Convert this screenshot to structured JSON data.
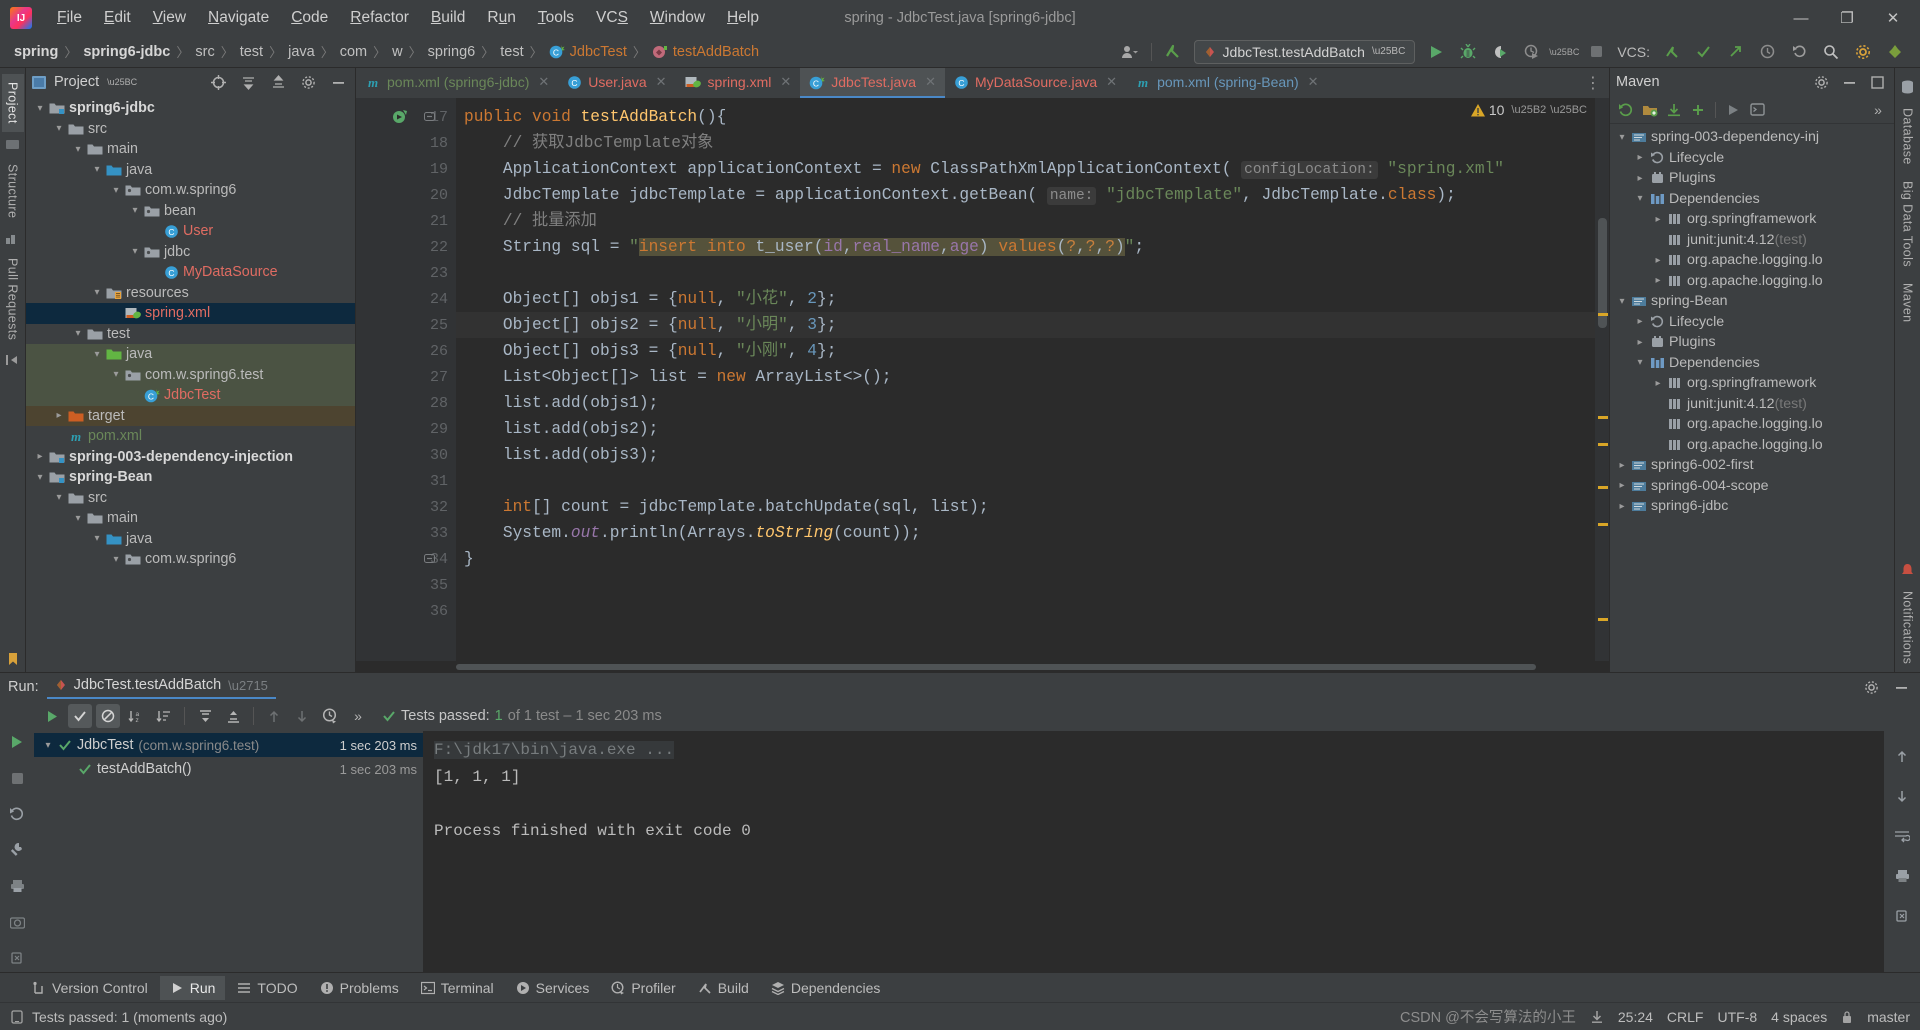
{
  "window": {
    "title": "spring - JdbcTest.java [spring6-jdbc]",
    "logo_icon": "intellij-idea-logo",
    "controls": {
      "minimize": "—",
      "maximize": "❐",
      "close": "✕"
    }
  },
  "menu": {
    "items": [
      "File",
      "Edit",
      "View",
      "Navigate",
      "Code",
      "Refactor",
      "Build",
      "Run",
      "Tools",
      "VCS",
      "Window",
      "Help"
    ]
  },
  "navbar": {
    "breadcrumbs": [
      {
        "label": "spring",
        "style": "bold"
      },
      {
        "label": "spring6-jdbc",
        "style": "bold"
      },
      {
        "label": "src",
        "style": "plain"
      },
      {
        "label": "test",
        "style": "plain"
      },
      {
        "label": "java",
        "style": "plain"
      },
      {
        "label": "com",
        "style": "plain"
      },
      {
        "label": "w",
        "style": "plain"
      },
      {
        "label": "spring6",
        "style": "plain"
      },
      {
        "label": "test",
        "style": "plain"
      },
      {
        "label": "JdbcTest",
        "style": "orange",
        "icon": "java-test-class-icon"
      },
      {
        "label": "testAddBatch",
        "style": "orange",
        "icon": "method-icon"
      }
    ],
    "separator": "〉",
    "run_config": "JdbcTest.testAddBatch",
    "vcs_label": "VCS:",
    "icons": [
      "user-icon",
      "vcs-update-icon",
      "run-icon",
      "debug-icon",
      "run-coverage-icon",
      "profiler-icon",
      "stop-icon",
      "search-icon",
      "settings-icon",
      "notifications-icon"
    ]
  },
  "left_strip": {
    "items": [
      "Project",
      "Structure",
      "Pull Requests"
    ],
    "active": "Project"
  },
  "right_strip": {
    "items": [
      "Database",
      "Big Data Tools",
      "Maven",
      "Notifications"
    ]
  },
  "project_panel": {
    "title": "Project",
    "toolbar_icons": [
      "locate-icon",
      "expand-all-icon",
      "collapse-all-icon",
      "settings-icon",
      "hide-icon"
    ],
    "tree": [
      {
        "label": "spring6-jdbc",
        "depth": 1,
        "chev": "down",
        "icon": "module-folder",
        "style": "bold"
      },
      {
        "label": "src",
        "depth": 2,
        "chev": "down",
        "icon": "folder"
      },
      {
        "label": "main",
        "depth": 3,
        "chev": "down",
        "icon": "folder"
      },
      {
        "label": "java",
        "depth": 4,
        "chev": "down",
        "icon": "source-folder-blue"
      },
      {
        "label": "com.w.spring6",
        "depth": 5,
        "chev": "down",
        "icon": "package"
      },
      {
        "label": "bean",
        "depth": 6,
        "chev": "down",
        "icon": "package"
      },
      {
        "label": "User",
        "depth": 7,
        "chev": "none",
        "icon": "class",
        "style": "red"
      },
      {
        "label": "jdbc",
        "depth": 6,
        "chev": "down",
        "icon": "package"
      },
      {
        "label": "MyDataSource",
        "depth": 7,
        "chev": "none",
        "icon": "class",
        "style": "red"
      },
      {
        "label": "resources",
        "depth": 4,
        "chev": "down",
        "icon": "resources-folder"
      },
      {
        "label": "spring.xml",
        "depth": 5,
        "chev": "none",
        "icon": "spring-xml",
        "style": "red",
        "row": "selected"
      },
      {
        "label": "test",
        "depth": 3,
        "chev": "down",
        "icon": "folder"
      },
      {
        "label": "java",
        "depth": 4,
        "chev": "down",
        "icon": "test-source-folder-green",
        "row": "testsrc"
      },
      {
        "label": "com.w.spring6.test",
        "depth": 5,
        "chev": "down",
        "icon": "package",
        "row": "testsrc"
      },
      {
        "label": "JdbcTest",
        "depth": 6,
        "chev": "none",
        "icon": "test-class",
        "style": "red",
        "row": "testsrc"
      },
      {
        "label": "target",
        "depth": 2,
        "chev": "right",
        "icon": "excluded-folder",
        "row": "targetrow"
      },
      {
        "label": "pom.xml",
        "depth": 2,
        "chev": "none",
        "icon": "maven-pom",
        "style": "green"
      },
      {
        "label": "spring-003-dependency-injection",
        "depth": 1,
        "chev": "right",
        "icon": "module-folder",
        "style": "bold"
      },
      {
        "label": "spring-Bean",
        "depth": 1,
        "chev": "down",
        "icon": "module-folder",
        "style": "bold"
      },
      {
        "label": "src",
        "depth": 2,
        "chev": "down",
        "icon": "folder"
      },
      {
        "label": "main",
        "depth": 3,
        "chev": "down",
        "icon": "folder"
      },
      {
        "label": "java",
        "depth": 4,
        "chev": "down",
        "icon": "source-folder-blue"
      },
      {
        "label": "com.w.spring6",
        "depth": 5,
        "chev": "down",
        "icon": "package"
      }
    ]
  },
  "editor": {
    "tabs": [
      {
        "label": "pom.xml (spring6-jdbc)",
        "icon": "maven-icon",
        "color": "green",
        "active": false
      },
      {
        "label": "User.java",
        "icon": "class-icon",
        "color": "red",
        "active": false
      },
      {
        "label": "spring.xml",
        "icon": "spring-icon",
        "color": "red",
        "active": false
      },
      {
        "label": "JdbcTest.java",
        "icon": "test-class-icon",
        "color": "red",
        "active": true
      },
      {
        "label": "MyDataSource.java",
        "icon": "class-icon",
        "color": "red",
        "active": false
      },
      {
        "label": "pom.xml (spring-Bean)",
        "icon": "maven-icon",
        "color": "blue",
        "active": false
      }
    ],
    "warning_count": "10",
    "warning_icon": "warning-triangle-icon",
    "first_line_number": 17,
    "lines": [
      {
        "n": 17,
        "gutter_icon": "run-test-icon",
        "fold": true
      },
      {
        "n": 18
      },
      {
        "n": 19
      },
      {
        "n": 20
      },
      {
        "n": 21
      },
      {
        "n": 22
      },
      {
        "n": 23
      },
      {
        "n": 24
      },
      {
        "n": 25,
        "current": true
      },
      {
        "n": 26
      },
      {
        "n": 27
      },
      {
        "n": 28
      },
      {
        "n": 29
      },
      {
        "n": 30
      },
      {
        "n": 31
      },
      {
        "n": 32
      },
      {
        "n": 33
      },
      {
        "n": 34,
        "fold": true
      },
      {
        "n": 35
      },
      {
        "n": 36
      }
    ],
    "code_text": [
      "public void testAddBatch(){",
      "    // 获取JdbcTemplate对象",
      "    ApplicationContext applicationContext = new ClassPathXmlApplicationContext( configLocation: \"spring.xml\"",
      "    JdbcTemplate jdbcTemplate = applicationContext.getBean( name: \"jdbcTemplate\", JdbcTemplate.class);",
      "    // 批量添加",
      "    String sql = \"insert into t_user(id,real_name,age) values(?,?,?)\";",
      "",
      "    Object[] objs1 = {null, \"小花\", 2};",
      "    Object[] objs2 = {null, \"小明\", 3};",
      "    Object[] objs3 = {null, \"小刚\", 4};",
      "    List<Object[]> list = new ArrayList<>();",
      "    list.add(objs1);",
      "    list.add(objs2);",
      "    list.add(objs3);",
      "",
      "    int[] count = jdbcTemplate.batchUpdate(sql, list);",
      "    System.out.println(Arrays.toString(count));",
      "}",
      "",
      ""
    ]
  },
  "maven_panel": {
    "title": "Maven",
    "toolbar_icons": [
      "reload-icon",
      "add-maven-project-icon",
      "download-sources-icon",
      "add-icon",
      "run-icon",
      "execute-goal-icon",
      "more-icon"
    ],
    "head_icons": [
      "settings-icon",
      "hide-icon",
      "collapse-icon"
    ],
    "tree": [
      {
        "label": "spring-003-dependency-inj",
        "depth": 1,
        "chev": "down",
        "icon": "maven-project"
      },
      {
        "label": "Lifecycle",
        "depth": 2,
        "chev": "right",
        "icon": "lifecycle"
      },
      {
        "label": "Plugins",
        "depth": 2,
        "chev": "right",
        "icon": "plugins"
      },
      {
        "label": "Dependencies",
        "depth": 2,
        "chev": "down",
        "icon": "dependencies"
      },
      {
        "label": "org.springframework",
        "depth": 3,
        "chev": "right",
        "icon": "library"
      },
      {
        "label": "junit:junit:4.12",
        "suffix": "(test)",
        "depth": 3,
        "chev": "none",
        "icon": "library"
      },
      {
        "label": "org.apache.logging.lo",
        "depth": 3,
        "chev": "right",
        "icon": "library"
      },
      {
        "label": "org.apache.logging.lo",
        "depth": 3,
        "chev": "right",
        "icon": "library"
      },
      {
        "label": "spring-Bean",
        "depth": 1,
        "chev": "down",
        "icon": "maven-project"
      },
      {
        "label": "Lifecycle",
        "depth": 2,
        "chev": "right",
        "icon": "lifecycle"
      },
      {
        "label": "Plugins",
        "depth": 2,
        "chev": "right",
        "icon": "plugins"
      },
      {
        "label": "Dependencies",
        "depth": 2,
        "chev": "down",
        "icon": "dependencies"
      },
      {
        "label": "org.springframework",
        "depth": 3,
        "chev": "right",
        "icon": "library"
      },
      {
        "label": "junit:junit:4.12",
        "suffix": "(test)",
        "depth": 3,
        "chev": "none",
        "icon": "library"
      },
      {
        "label": "org.apache.logging.lo",
        "depth": 3,
        "chev": "none",
        "icon": "library"
      },
      {
        "label": "org.apache.logging.lo",
        "depth": 3,
        "chev": "none",
        "icon": "library"
      },
      {
        "label": "spring6-002-first",
        "depth": 1,
        "chev": "right",
        "icon": "maven-project"
      },
      {
        "label": "spring6-004-scope",
        "depth": 1,
        "chev": "right",
        "icon": "maven-project"
      },
      {
        "label": "spring6-jdbc",
        "depth": 1,
        "chev": "right",
        "icon": "maven-project"
      }
    ]
  },
  "run_panel": {
    "label": "Run:",
    "tab_title": "JdbcTest.testAddBatch",
    "toolbar_icons": [
      "rerun-icon",
      "show-passed-icon",
      "show-ignored-icon",
      "sort-alphabetically-icon",
      "sort-by-duration-icon",
      "expand-all-icon",
      "collapse-all-icon",
      "prev-failed-icon",
      "next-failed-icon",
      "history-icon",
      "more-icon"
    ],
    "status_prefix": "Tests passed:",
    "status_count": "1",
    "status_suffix": "of 1 test – 1 sec 203 ms",
    "tests": [
      {
        "label": "JdbcTest",
        "package": "(com.w.spring6.test)",
        "duration": "1 sec 203 ms",
        "depth": 1,
        "chev": "down",
        "selected": true
      },
      {
        "label": "testAddBatch()",
        "package": "",
        "duration": "1 sec 203 ms",
        "depth": 2,
        "chev": "none",
        "selected": false
      }
    ],
    "console": [
      {
        "text": "F:\\jdk17\\bin\\java.exe ...",
        "style": "cmd"
      },
      {
        "text": "[1, 1, 1]",
        "style": "plain"
      },
      {
        "text": "",
        "style": "plain"
      },
      {
        "text": "Process finished with exit code 0",
        "style": "plain"
      }
    ],
    "settings_icon": "gear-icon",
    "hide_icon": "hide-icon"
  },
  "toolwindow_bar": {
    "items": [
      {
        "label": "Version Control",
        "icon": "branch-icon",
        "active": false
      },
      {
        "label": "Run",
        "icon": "run-icon",
        "active": true
      },
      {
        "label": "TODO",
        "icon": "todo-icon",
        "active": false
      },
      {
        "label": "Problems",
        "icon": "problems-icon",
        "active": false
      },
      {
        "label": "Terminal",
        "icon": "terminal-icon",
        "active": false
      },
      {
        "label": "Services",
        "icon": "services-icon",
        "active": false
      },
      {
        "label": "Profiler",
        "icon": "profiler-icon",
        "active": false
      },
      {
        "label": "Build",
        "icon": "build-icon",
        "active": false
      },
      {
        "label": "Dependencies",
        "icon": "dependencies-icon",
        "active": false
      }
    ]
  },
  "statusbar": {
    "message": "Tests passed: 1 (moments ago)",
    "message_icon": "test-status-icon",
    "caret_position": "25:24",
    "line_separator": "CRLF",
    "encoding": "UTF-8",
    "indent": "4 spaces",
    "branch": "master",
    "watermark": "CSDN @不会写算法的小王",
    "download_icon": "download-icon",
    "lock_icon": "lock-icon"
  },
  "colors": {
    "bg_panel": "#3c3f41",
    "bg_editor": "#2b2b2b",
    "accent_blue": "#4a88c7",
    "selection": "#0d293e",
    "green": "#499c54",
    "warning": "#d9a627",
    "string": "#6a8759",
    "keyword": "#cc7832",
    "method": "#ffc66d",
    "number": "#6897bb",
    "field": "#9876aa",
    "comment": "#808080",
    "red_file": "#e06c62"
  }
}
